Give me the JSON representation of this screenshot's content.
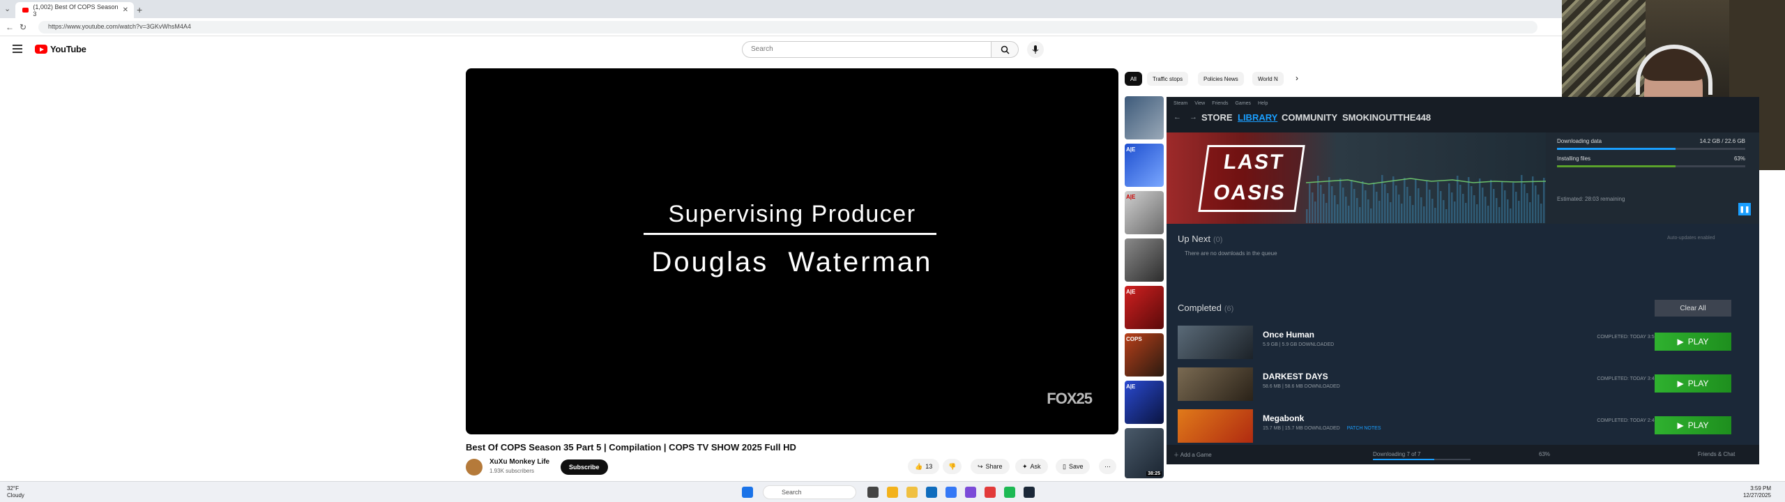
{
  "browser": {
    "tab_title": "(1,002) Best Of COPS Season 3",
    "url": "https://www.youtube.com/watch?v=3GKvWhsM4A4"
  },
  "youtube": {
    "logo_text": "YouTube",
    "search_placeholder": "Search",
    "video": {
      "credit_title": "Supervising Producer",
      "credit_name": "Douglas Waterman",
      "watermark": "FOX25",
      "title": "Best Of COPS Season 35 Part 5 | Compilation | COPS TV SHOW 2025 Full HD",
      "channel": "XuXu Monkey Life",
      "subscribers": "1.93K subscribers",
      "subscribe_label": "Subscribe",
      "likes": "13",
      "share_label": "Share",
      "ask_label": "Ask",
      "save_label": "Save"
    },
    "chips": [
      "All",
      "Traffic stops",
      "Policies News",
      "World N"
    ],
    "thumb_duration": "38:25"
  },
  "steam": {
    "menu": [
      "Steam",
      "View",
      "Friends",
      "Games",
      "Help"
    ],
    "tabs": [
      "STORE",
      "LIBRARY",
      "COMMUNITY",
      "SMOKINOUTTHE448"
    ],
    "selected_tab": "LIBRARY",
    "banner_game": "LAST OASIS",
    "downloading_label": "Downloading data",
    "downloading_value": "14.2 GB / 22.6 GB",
    "installing_label": "Installing files",
    "installing_value": "63%",
    "installing_progress": 0.63,
    "downloading_progress": 0.63,
    "estimated": "Estimated: 28:03 remaining",
    "up_next_title": "Up Next",
    "up_next_count": "(0)",
    "auto_updates": "Auto-updates enabled",
    "queue_empty": "There are no downloads in the queue",
    "completed_title": "Completed",
    "completed_count": "(6)",
    "clear_all": "Clear All",
    "games": [
      {
        "name": "Once Human",
        "size": "5.9 GB | 5.9 GB DOWNLOADED",
        "completed": "COMPLETED: TODAY 3:51 PM",
        "play": "PLAY",
        "patch": ""
      },
      {
        "name": "DARKEST DAYS",
        "size": "58.6 MB | 58.6 MB DOWNLOADED",
        "completed": "COMPLETED: TODAY 3:46 PM",
        "play": "PLAY",
        "patch": ""
      },
      {
        "name": "Megabonk",
        "size": "15.7 MB | 15.7 MB DOWNLOADED",
        "completed": "COMPLETED: TODAY 2:49 PM",
        "play": "PLAY",
        "patch": "PATCH NOTES"
      }
    ],
    "bottom": {
      "add_game": "Add a Game",
      "downloading_status": "Downloading 7 of 7",
      "downloading_pct": "63%",
      "friends": "Friends & Chat"
    }
  },
  "taskbar": {
    "weather_temp": "32°F",
    "weather_text": "Cloudy",
    "search_label": "Search",
    "time": "3:59 PM",
    "date": "12/27/2025"
  }
}
